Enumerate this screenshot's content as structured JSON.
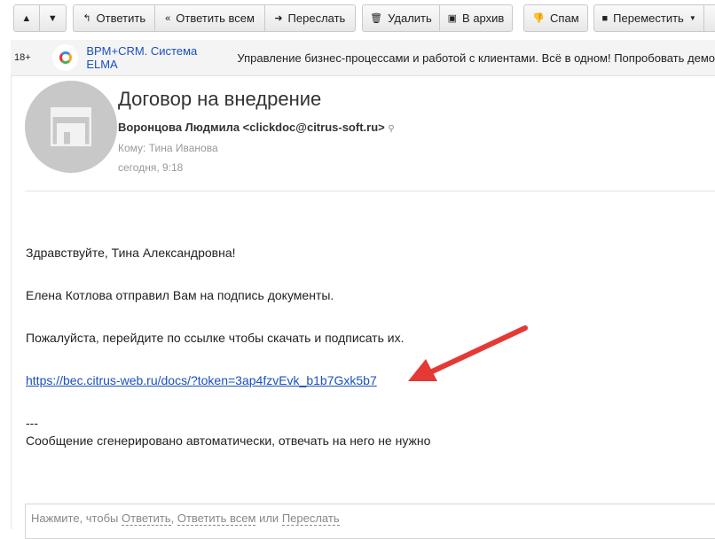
{
  "toolbar": {
    "reply": "Ответить",
    "reply_all": "Ответить всем",
    "forward": "Переслать",
    "delete": "Удалить",
    "archive": "В архив",
    "spam": "Спам",
    "move": "Переместить"
  },
  "ad": {
    "age": "18+",
    "title": "BPM+CRM. Система ELMA",
    "text": "Управление бизнес-процессами и работой с клиентами. Всё в одном! Попробовать демо"
  },
  "email": {
    "subject": "Договор на внедрение",
    "from": "Воронцова Людмила <clickdoc@citrus-soft.ru>",
    "to_label": "Кому:",
    "to": "Тина Иванова",
    "date": "сегодня, 9:18",
    "greeting": "Здравствуйте, Тина Александровна!",
    "line1": "Елена Котлова отправил Вам на подпись документы.",
    "line2": "Пожалуйста, перейдите по ссылке чтобы скачать и подписать их.",
    "link": "https://bec.citrus-web.ru/docs/?token=3ap4fzvEvk_b1b7Gxk5b7",
    "sep": "---",
    "footer": "Сообщение сгенерировано автоматически, отвечать на него не нужно"
  },
  "quick_reply": {
    "prefix": "Нажмите, чтобы",
    "reply": "Ответить",
    "comma": ",",
    "reply_all": "Ответить всем",
    "or": "или",
    "forward": "Переслать"
  },
  "colors": {
    "arrow": "#e53935",
    "link": "#1a4fc0"
  }
}
